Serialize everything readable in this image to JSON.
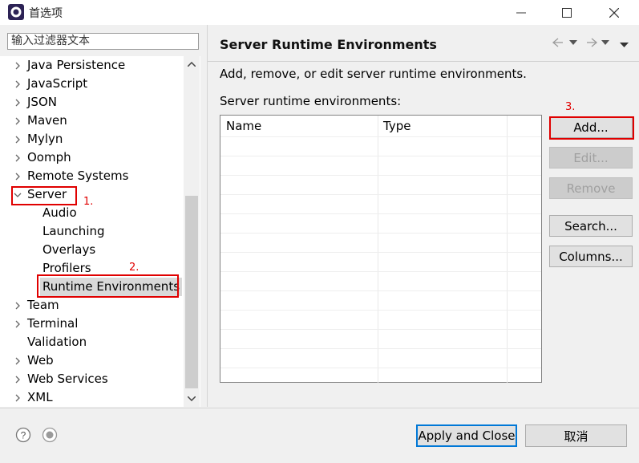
{
  "window": {
    "title": "首选项"
  },
  "filter": {
    "placeholder": "输入过滤器文本"
  },
  "tree": {
    "items": [
      {
        "label": "Java Persistence",
        "chevron": "right"
      },
      {
        "label": "JavaScript",
        "chevron": "right"
      },
      {
        "label": "JSON",
        "chevron": "right"
      },
      {
        "label": "Maven",
        "chevron": "right"
      },
      {
        "label": "Mylyn",
        "chevron": "right"
      },
      {
        "label": "Oomph",
        "chevron": "right"
      },
      {
        "label": "Remote Systems",
        "chevron": "right"
      },
      {
        "label": "Server",
        "chevron": "down"
      },
      {
        "label": "Audio",
        "chevron": ""
      },
      {
        "label": "Launching",
        "chevron": ""
      },
      {
        "label": "Overlays",
        "chevron": ""
      },
      {
        "label": "Profilers",
        "chevron": ""
      },
      {
        "label": "Runtime Environments",
        "chevron": ""
      },
      {
        "label": "Team",
        "chevron": "right"
      },
      {
        "label": "Terminal",
        "chevron": "right"
      },
      {
        "label": "Validation",
        "chevron": ""
      },
      {
        "label": "Web",
        "chevron": "right"
      },
      {
        "label": "Web Services",
        "chevron": "right"
      },
      {
        "label": "XML",
        "chevron": "right"
      }
    ]
  },
  "annotations": {
    "step1": "1.",
    "step2": "2.",
    "step3": "3."
  },
  "page": {
    "title": "Server Runtime Environments",
    "description": "Add, remove, or edit server runtime environments.",
    "table_label": "Server runtime environments:",
    "columns": [
      "Name",
      "Type"
    ]
  },
  "buttons": {
    "add": "Add...",
    "edit": "Edit...",
    "remove": "Remove",
    "search": "Search...",
    "columns": "Columns...",
    "apply_close": "Apply and Close",
    "cancel": "取消"
  },
  "colors": {
    "annotation_red": "#e00000",
    "focus_blue": "#0078d7"
  }
}
